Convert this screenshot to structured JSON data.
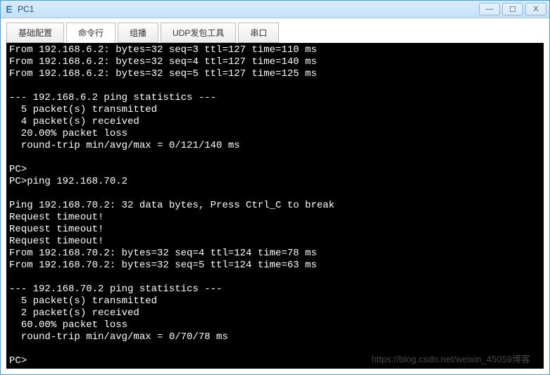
{
  "window": {
    "title": "PC1",
    "icon_glyph": "E"
  },
  "controls": {
    "minimize": "—",
    "maximize": "☐",
    "close": "X"
  },
  "tabs": [
    {
      "label": "基础配置",
      "active": false
    },
    {
      "label": "命令行",
      "active": true
    },
    {
      "label": "组播",
      "active": false
    },
    {
      "label": "UDP发包工具",
      "active": false
    },
    {
      "label": "串口",
      "active": false
    }
  ],
  "terminal_lines": [
    "From 192.168.6.2: bytes=32 seq=3 ttl=127 time=110 ms",
    "From 192.168.6.2: bytes=32 seq=4 ttl=127 time=140 ms",
    "From 192.168.6.2: bytes=32 seq=5 ttl=127 time=125 ms",
    "",
    "--- 192.168.6.2 ping statistics ---",
    "  5 packet(s) transmitted",
    "  4 packet(s) received",
    "  20.00% packet loss",
    "  round-trip min/avg/max = 0/121/140 ms",
    "",
    "PC>",
    "PC>ping 192.168.70.2",
    "",
    "Ping 192.168.70.2: 32 data bytes, Press Ctrl_C to break",
    "Request timeout!",
    "Request timeout!",
    "Request timeout!",
    "From 192.168.70.2: bytes=32 seq=4 ttl=124 time=78 ms",
    "From 192.168.70.2: bytes=32 seq=5 ttl=124 time=63 ms",
    "",
    "--- 192.168.70.2 ping statistics ---",
    "  5 packet(s) transmitted",
    "  2 packet(s) received",
    "  60.00% packet loss",
    "  round-trip min/avg/max = 0/70/78 ms",
    "",
    "PC>"
  ],
  "watermark": "https://blog.csdn.net/weixin_45059博客"
}
